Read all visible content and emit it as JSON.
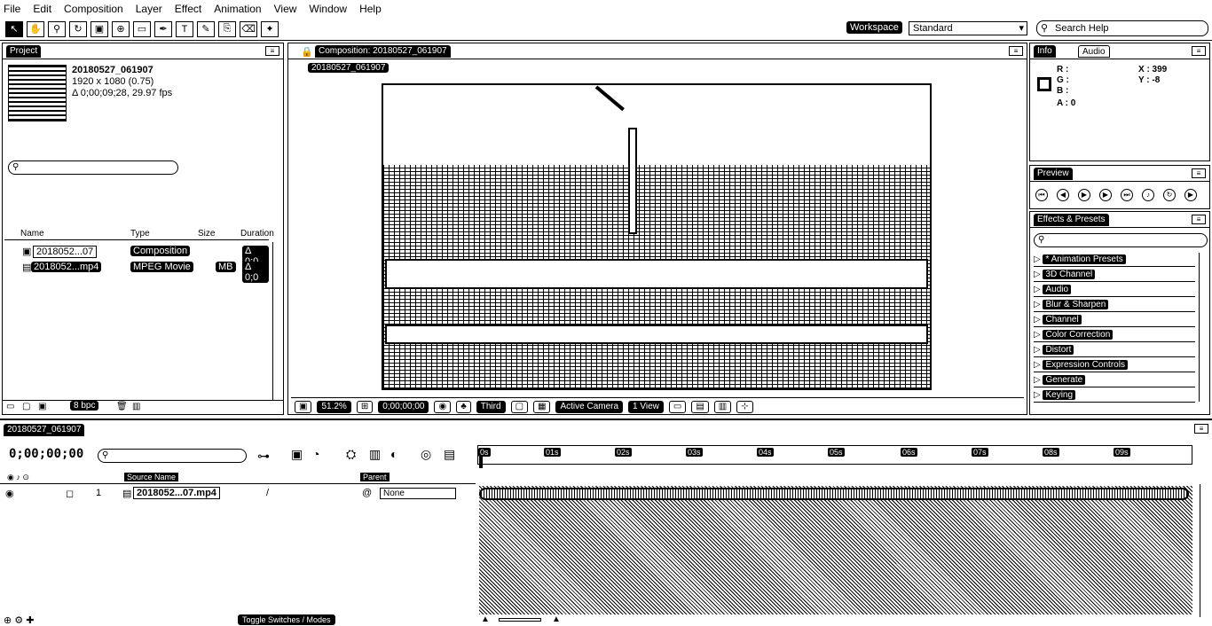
{
  "menu": [
    "File",
    "Edit",
    "Composition",
    "Layer",
    "Effect",
    "Animation",
    "View",
    "Window",
    "Help"
  ],
  "workspace": {
    "label": "Workspace",
    "value": "Standard"
  },
  "search_help": {
    "placeholder": "Search Help"
  },
  "project": {
    "tab": "Project",
    "item_name": "20180527_061907",
    "item_dims": "1920 x 1080 (0.75)",
    "item_duration": "Δ 0;00;09;28, 29.97 fps",
    "columns": {
      "name": "Name",
      "type": "Type",
      "size": "Size",
      "duration": "Duration"
    },
    "rows": [
      {
        "name": "2018052...07",
        "type": "Composition",
        "size": "",
        "duration": "Δ 0;0"
      },
      {
        "name": "2018052...mp4",
        "type": "MPEG Movie",
        "size": "MB",
        "duration": "Δ 0;0"
      }
    ],
    "bpc": "8 bpc"
  },
  "composition": {
    "tab": "Composition: 20180527_061907",
    "sub_tab": "20180527_061907",
    "controls": {
      "zoom": "51.2%",
      "timecode": "0;00;00;00",
      "resolution": "Third",
      "camera": "Active Camera",
      "view": "1 View"
    }
  },
  "info": {
    "tab": "Info",
    "tab2": "Audio",
    "r": "R :",
    "g": "G :",
    "b": "B :",
    "a": "A : 0",
    "x": "X : 399",
    "y": "Y : -8"
  },
  "preview": {
    "tab": "Preview"
  },
  "effects": {
    "tab": "Effects & Presets",
    "items": [
      "* Animation Presets",
      "3D Channel",
      "Audio",
      "Blur & Sharpen",
      "Channel",
      "Color Correction",
      "Distort",
      "Expression Controls",
      "Generate",
      "Keying"
    ]
  },
  "timeline": {
    "tab": "20180527_061907",
    "time": "0;00;00;00",
    "col_source": "Source Name",
    "col_parent": "Parent",
    "layer_name": "2018052...07.mp4",
    "layer_parent": "None",
    "ticks": [
      "0s",
      "01s",
      "02s",
      "03s",
      "04s",
      "05s",
      "06s",
      "07s",
      "08s",
      "09s"
    ],
    "toggle_label": "Toggle Switches / Modes"
  }
}
